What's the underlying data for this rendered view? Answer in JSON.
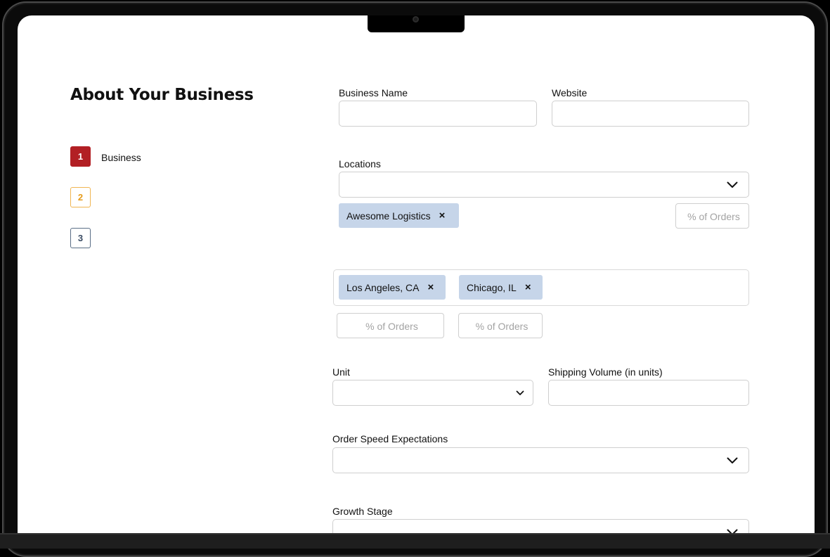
{
  "page": {
    "title": "About Your Business"
  },
  "steps": [
    {
      "number": "1",
      "label": "Business"
    },
    {
      "number": "2"
    },
    {
      "number": "3"
    }
  ],
  "form": {
    "business_name_label": "Business Name",
    "business_name_value": "",
    "website_label": "Website",
    "website_value": "",
    "locations_label": "Locations",
    "locations_value": "",
    "location_chip": {
      "label": "Awesome Logistics",
      "remove": "×"
    },
    "location_pct_placeholder": "% of Orders",
    "city_chips": [
      {
        "label": "Los Angeles, CA",
        "remove": "×",
        "pct_placeholder": "% of Orders"
      },
      {
        "label": "Chicago, IL",
        "remove": "×",
        "pct_placeholder": "% of Orders"
      }
    ],
    "unit_label": "Unit",
    "unit_value": "",
    "shipping_volume_label": "Shipping Volume (in units)",
    "shipping_volume_value": "",
    "order_speed_label": "Order Speed Expectations",
    "order_speed_value": "",
    "growth_stage_label": "Growth Stage",
    "growth_stage_value": ""
  },
  "icons": {
    "dropdown": "chevron-down-icon",
    "remove": "close-icon"
  },
  "colors": {
    "step_active": "#b21f24",
    "step_two": "#f0b551",
    "step_three": "#5a6e86",
    "chip_bg": "#c6d5e9"
  }
}
